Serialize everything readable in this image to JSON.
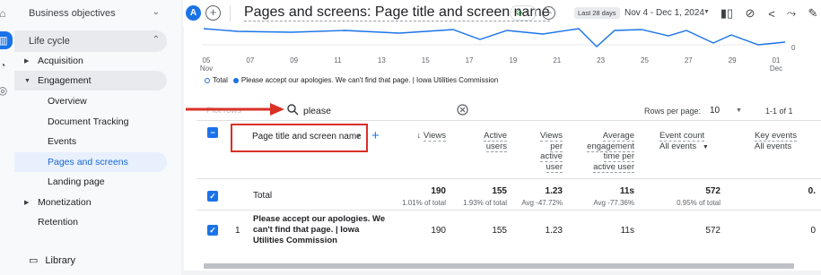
{
  "header": {
    "avatar_letter": "A",
    "page_title": "Pages and screens: Page title and screen name",
    "date_badge": "Last 28 days",
    "date_range": "Nov 4 - Dec 1, 2024"
  },
  "sidebar": {
    "business_objectives": "Business objectives",
    "life_cycle": "Life cycle",
    "items": [
      {
        "label": "Acquisition"
      },
      {
        "label": "Engagement"
      },
      {
        "label": "Overview"
      },
      {
        "label": "Document Tracking"
      },
      {
        "label": "Events"
      },
      {
        "label": "Pages and screens"
      },
      {
        "label": "Landing page"
      },
      {
        "label": "Monetization"
      },
      {
        "label": "Retention"
      }
    ],
    "library": "Library"
  },
  "chart": {
    "x_ticks": [
      {
        "day": "05",
        "month": "Nov"
      },
      {
        "day": "07",
        "month": ""
      },
      {
        "day": "09",
        "month": ""
      },
      {
        "day": "11",
        "month": ""
      },
      {
        "day": "13",
        "month": ""
      },
      {
        "day": "15",
        "month": ""
      },
      {
        "day": "17",
        "month": ""
      },
      {
        "day": "19",
        "month": ""
      },
      {
        "day": "21",
        "month": ""
      },
      {
        "day": "23",
        "month": ""
      },
      {
        "day": "25",
        "month": ""
      },
      {
        "day": "27",
        "month": ""
      },
      {
        "day": "29",
        "month": ""
      },
      {
        "day": "01",
        "month": "Dec"
      }
    ],
    "y_zero": "0",
    "legend_total": "Total",
    "legend_page": "Please accept our apologies. We can't find that page. | Iowa Utilities Commission",
    "color_line": "#1a73e8"
  },
  "search": {
    "placeholder": "Plot rows",
    "value": "please"
  },
  "pagination": {
    "rows_label": "Rows per page:",
    "rows_value": "10",
    "range": "1-1 of 1"
  },
  "table": {
    "dimension": "Page title and screen name",
    "columns": [
      {
        "lines": [
          "Views"
        ],
        "sort": true
      },
      {
        "lines": [
          "Active",
          "users"
        ]
      },
      {
        "lines": [
          "Views",
          "per",
          "active",
          "user"
        ]
      },
      {
        "lines": [
          "Average",
          "engagement",
          "time per",
          "active user"
        ]
      },
      {
        "lines": [
          "Event count"
        ],
        "sub": "All events"
      },
      {
        "lines": [
          "Key events"
        ],
        "sub": "All events"
      }
    ],
    "total": {
      "label": "Total",
      "views": "190",
      "views_sub": "1.01% of total",
      "users": "155",
      "users_sub": "1.93% of total",
      "vpu": "1.23",
      "vpu_sub": "Avg -47.72%",
      "aet": "11s",
      "aet_sub": "Avg -77.36%",
      "events": "572",
      "events_sub": "0.95% of total",
      "key": "0."
    },
    "rows": [
      {
        "index": "1",
        "title": "Please accept our apologies. We can't find that page. | Iowa Utilities Commission",
        "views": "190",
        "users": "155",
        "vpu": "1.23",
        "aet": "11s",
        "events": "572",
        "key": "0"
      }
    ]
  },
  "icons": {
    "annotation_color": "#d93025",
    "accent": "#1a73e8"
  }
}
